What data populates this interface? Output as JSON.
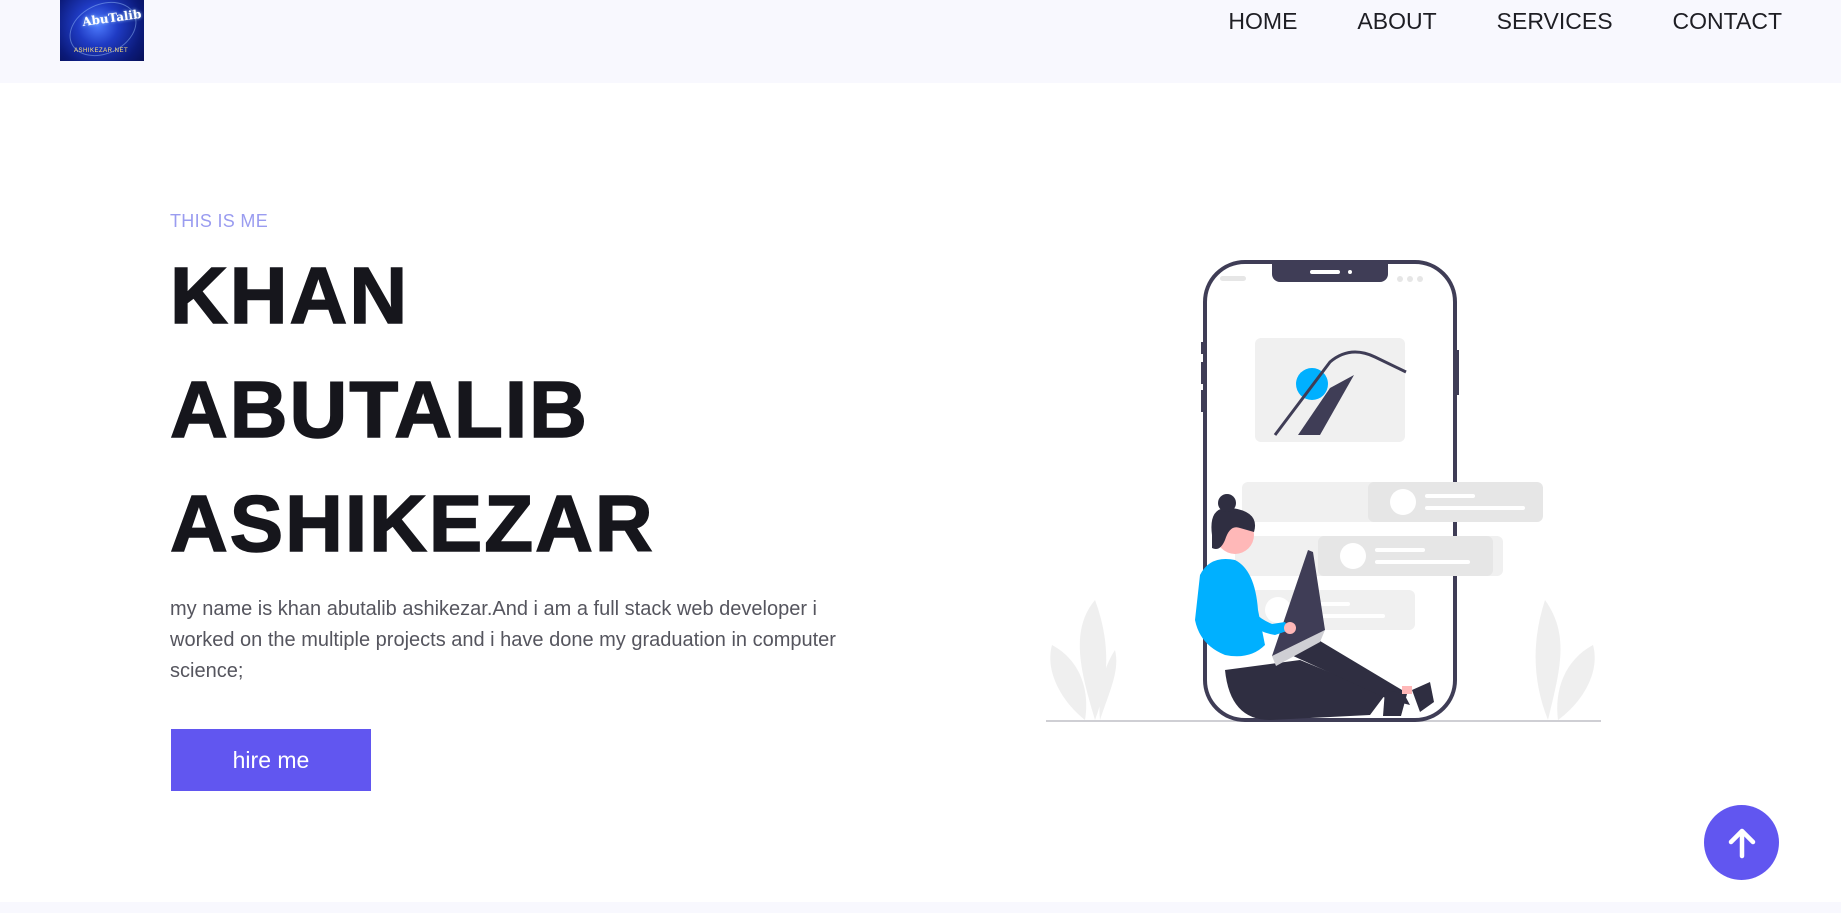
{
  "header": {
    "logo_text": "AbuTalib",
    "logo_subtext": "ASHIKEZAR.NET",
    "nav": [
      {
        "label": "HOME"
      },
      {
        "label": "ABOUT"
      },
      {
        "label": "SERVICES"
      },
      {
        "label": "CONTACT"
      }
    ]
  },
  "hero": {
    "eyebrow": "THIS IS ME",
    "name_lines": [
      "KHAN",
      "ABUTALIB",
      "ASHIKEZAR"
    ],
    "bio": "my name is khan abutalib ashikezar.And i am a full stack web developer i worked on the multiple projects and i have done my graduation in computer science;",
    "cta_label": "hire me"
  },
  "icons": {
    "scroll_top": "arrow-up-icon",
    "illustration": "person-with-laptop-and-phone-illustration"
  },
  "colors": {
    "accent": "#6156f0",
    "eyebrow": "#9a9cf0",
    "header_bg": "#f8f8fe",
    "illustration_blue": "#00b0ff",
    "illustration_dark": "#3f3d56"
  }
}
